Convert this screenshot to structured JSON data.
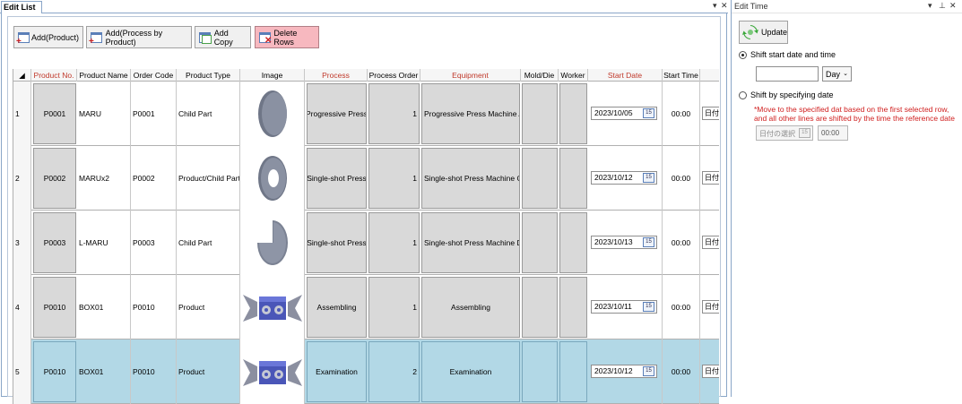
{
  "left_panel": {
    "tab_title": "Edit List",
    "pane_controls": [
      "▾",
      "✕"
    ],
    "toolbar": {
      "add_product": "Add(Product)",
      "add_process": "Add(Process by Product)",
      "add_copy": "Add Copy",
      "delete_rows": "Delete Rows"
    },
    "columns": {
      "product_no": "Product No.",
      "product_name": "Product Name",
      "order_code": "Order Code",
      "product_type": "Product Type",
      "image": "Image",
      "process": "Process",
      "process_order": "Process Order",
      "equipment": "Equipment",
      "mold_die": "Mold/Die",
      "worker": "Worker",
      "start_date": "Start Date",
      "start_time": "Start Time"
    },
    "rows": [
      {
        "row_no": "1",
        "product_no": "P0001",
        "product_name": "MARU",
        "order_code": "P0001",
        "product_type": "Child Part",
        "image": "disc",
        "process": "Progressive Press",
        "process_order": "1",
        "equipment": "Progressive Press Machine A",
        "start_date": "2023/10/05",
        "cal_label": "15",
        "start_time": "00:00",
        "extra": "日付"
      },
      {
        "row_no": "2",
        "product_no": "P0002",
        "product_name": "MARUx2",
        "order_code": "P0002",
        "product_type": "Product/Child Part",
        "image": "ring",
        "process": "Single-shot Press",
        "process_order": "1",
        "equipment": "Single-shot Press Machine C",
        "start_date": "2023/10/12",
        "cal_label": "15",
        "start_time": "00:00",
        "extra": "日付"
      },
      {
        "row_no": "3",
        "product_no": "P0003",
        "product_name": "L-MARU",
        "order_code": "P0003",
        "product_type": "Child Part",
        "image": "pie",
        "process": "Single-shot Press",
        "process_order": "1",
        "equipment": "Single-shot Press Machine D",
        "start_date": "2023/10/13",
        "cal_label": "15",
        "start_time": "00:00",
        "extra": "日付"
      },
      {
        "row_no": "4",
        "product_no": "P0010",
        "product_name": "BOX01",
        "order_code": "P0010",
        "product_type": "Product",
        "image": "box",
        "process": "Assembling",
        "process_order": "1",
        "equipment": "Assembling",
        "start_date": "2023/10/11",
        "cal_label": "15",
        "start_time": "00:00",
        "extra": "日付"
      },
      {
        "row_no": "5",
        "product_no": "P0010",
        "product_name": "BOX01",
        "order_code": "P0010",
        "product_type": "Product",
        "image": "box",
        "process": "Examination",
        "process_order": "2",
        "equipment": "Examination",
        "start_date": "2023/10/12",
        "cal_label": "15",
        "start_time": "00:00",
        "extra": "日付"
      }
    ]
  },
  "right_panel": {
    "title": "Edit Time",
    "pane_controls": [
      "▾",
      "⊥",
      "✕"
    ],
    "update_label": "Update",
    "shift_start_label": "Shift start date and time",
    "unit_value": "Day",
    "shift_specify_label": "Shift by specifying date",
    "note_line1": "*Move to the specified dat based on the first selected row,",
    "note_line2": "and all other lines are shifted by the time the reference date",
    "date_placeholder": "日付の選択",
    "cal_label": "15",
    "time_value": "00:00"
  },
  "colors": {
    "selected_row": "#b2d8e6",
    "required_header": "#c0392b",
    "delete_button": "#f7b8bf",
    "note_red": "#d02020"
  }
}
